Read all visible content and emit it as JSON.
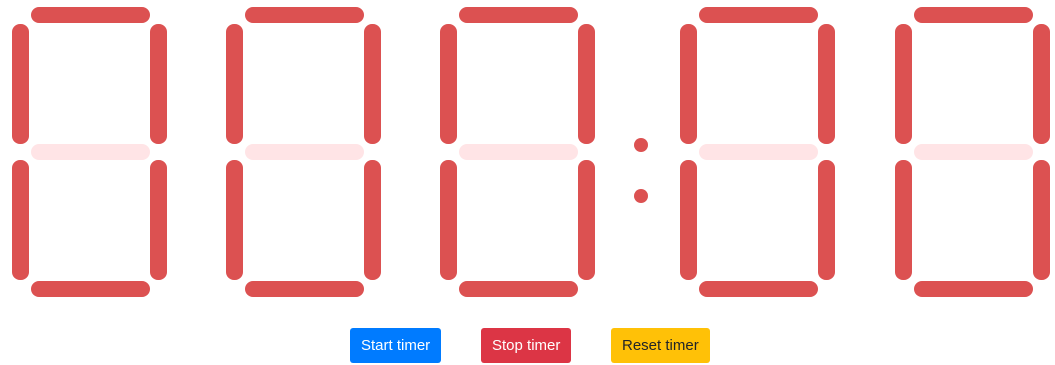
{
  "colors": {
    "segment_on": "#dc5151",
    "segment_off": "#ffe4e6",
    "start_button": "#007bff",
    "stop_button": "#dc3545",
    "reset_button": "#ffc107"
  },
  "timer": {
    "digits": [
      "0",
      "0",
      "0",
      "0",
      "0"
    ],
    "separator": ":"
  },
  "controls": {
    "start_label": "Start timer",
    "stop_label": "Stop timer",
    "reset_label": "Reset timer"
  }
}
